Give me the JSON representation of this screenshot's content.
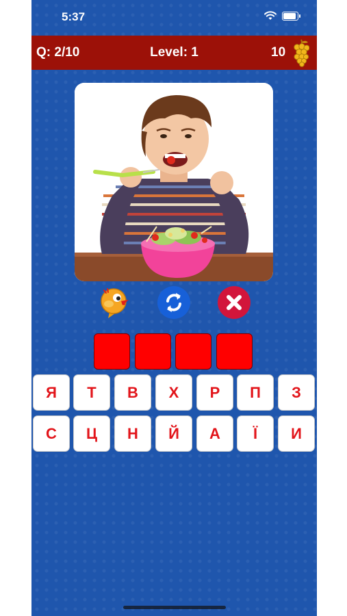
{
  "status": {
    "time": "5:37"
  },
  "header": {
    "question": "Q: 2/10",
    "level": "Level: 1",
    "coins": "10"
  },
  "icons": {
    "grapes": "grapes-icon",
    "hint": "bird-hint-icon",
    "shuffle": "refresh-icon",
    "clear": "close-icon"
  },
  "answer": {
    "slots": [
      "",
      "",
      "",
      ""
    ]
  },
  "keyboard": {
    "row1": [
      "Я",
      "Т",
      "В",
      "Х",
      "Р",
      "П",
      "З"
    ],
    "row2": [
      "С",
      "Ц",
      "Н",
      "Й",
      "А",
      "Ї",
      "И"
    ]
  },
  "colors": {
    "background": "#1f56ad",
    "header": "#9c1108",
    "slot": "#ff0000",
    "key_text": "#e2141a"
  }
}
